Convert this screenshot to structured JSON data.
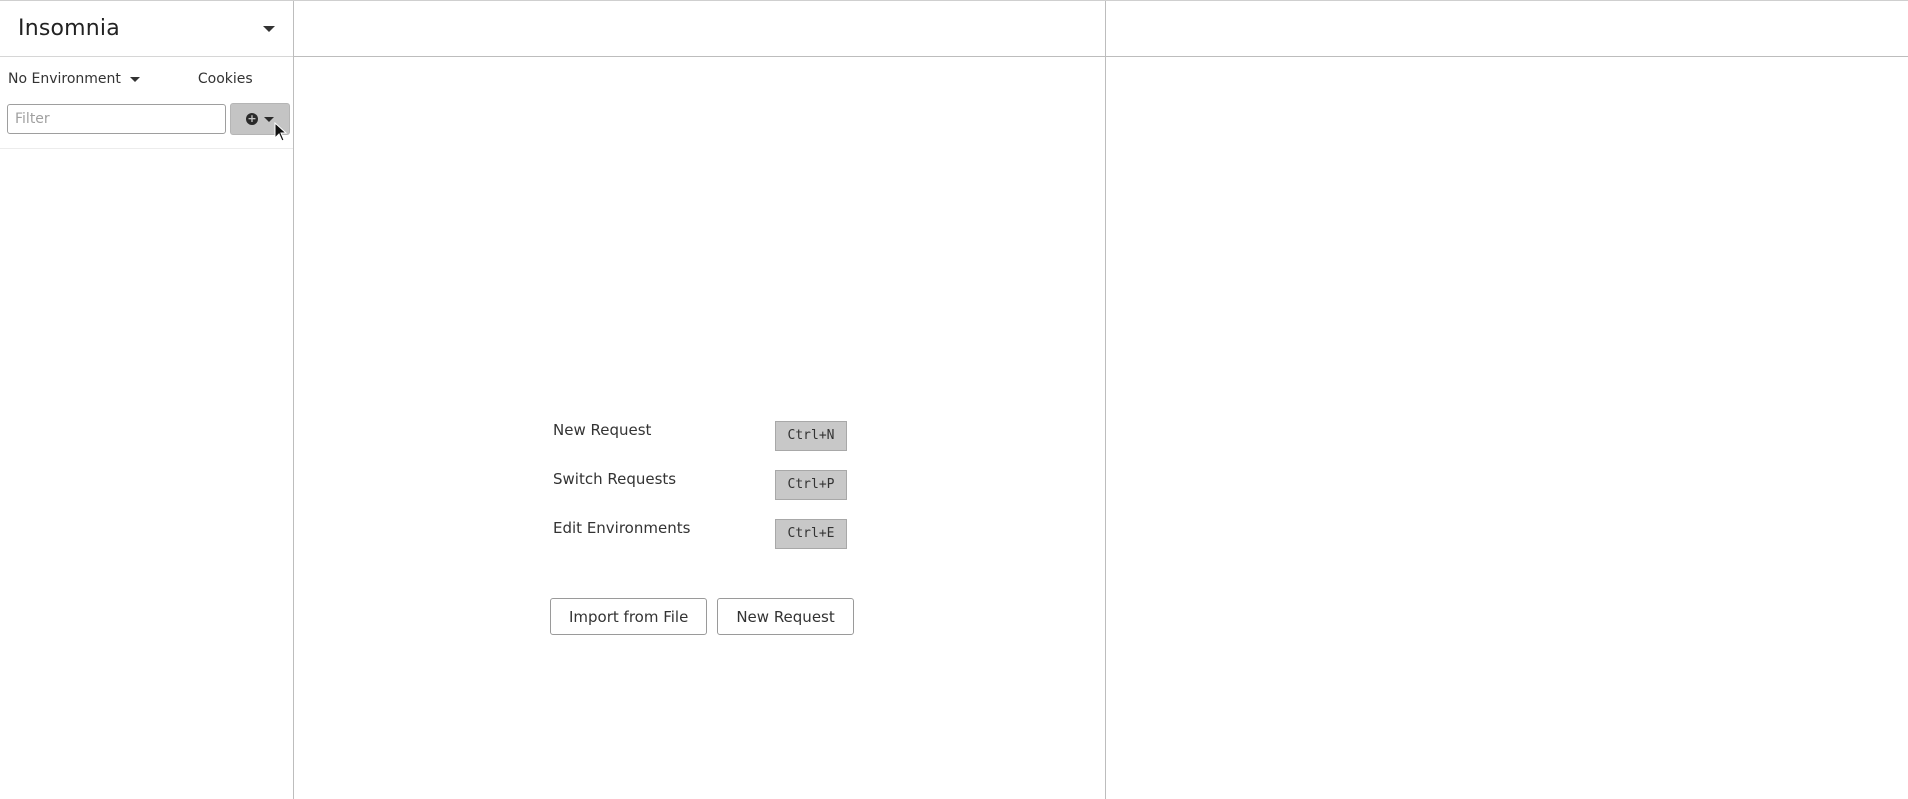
{
  "sidebar": {
    "workspace_title": "Insomnia",
    "environment_label": "No Environment",
    "cookies_label": "Cookies",
    "filter_placeholder": "Filter"
  },
  "empty_state": {
    "shortcuts": [
      {
        "label": "New Request",
        "keys": "Ctrl+N"
      },
      {
        "label": "Switch Requests",
        "keys": "Ctrl+P"
      },
      {
        "label": "Edit Environments",
        "keys": "Ctrl+E"
      }
    ],
    "import_button": "Import from File",
    "new_request_button": "New Request"
  },
  "icons": {
    "workspace_dropdown": "chevron-down-icon",
    "environment_dropdown": "chevron-down-icon",
    "add": "plus-circle-icon",
    "add_dropdown": "chevron-down-icon"
  }
}
